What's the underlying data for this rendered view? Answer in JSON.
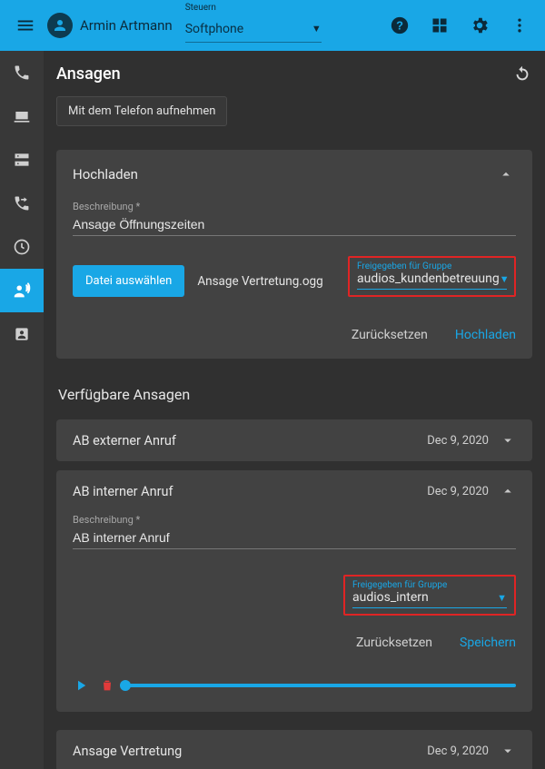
{
  "header": {
    "username": "Armin Artmann",
    "control_label": "Steuern",
    "control_value": "Softphone"
  },
  "page": {
    "title": "Ansagen",
    "record_button_label": "Mit dem Telefon aufnehmen",
    "upload_card": {
      "title": "Hochladen",
      "desc_label": "Beschreibung *",
      "desc_value": "Ansage Öffnungszeiten",
      "choose_file_label": "Datei auswählen",
      "filename": "Ansage Vertretung.ogg",
      "group_label": "Freigegeben für Gruppe",
      "group_value": "audios_kundenbetreuung",
      "reset_label": "Zurücksetzen",
      "submit_label": "Hochladen"
    },
    "list_heading": "Verfügbare Ansagen",
    "items": [
      {
        "title": "AB externer Anruf",
        "date": "Dec 9, 2020",
        "expanded": false
      },
      {
        "title": "AB interner Anruf",
        "date": "Dec 9, 2020",
        "expanded": true,
        "desc_label": "Beschreibung *",
        "desc_value": "AB interner Anruf",
        "group_label": "Freigegeben für Gruppe",
        "group_value": "audios_intern",
        "reset_label": "Zurücksetzen",
        "save_label": "Speichern"
      },
      {
        "title": "Ansage Vertretung",
        "date": "Dec 9, 2020",
        "expanded": false
      }
    ]
  }
}
